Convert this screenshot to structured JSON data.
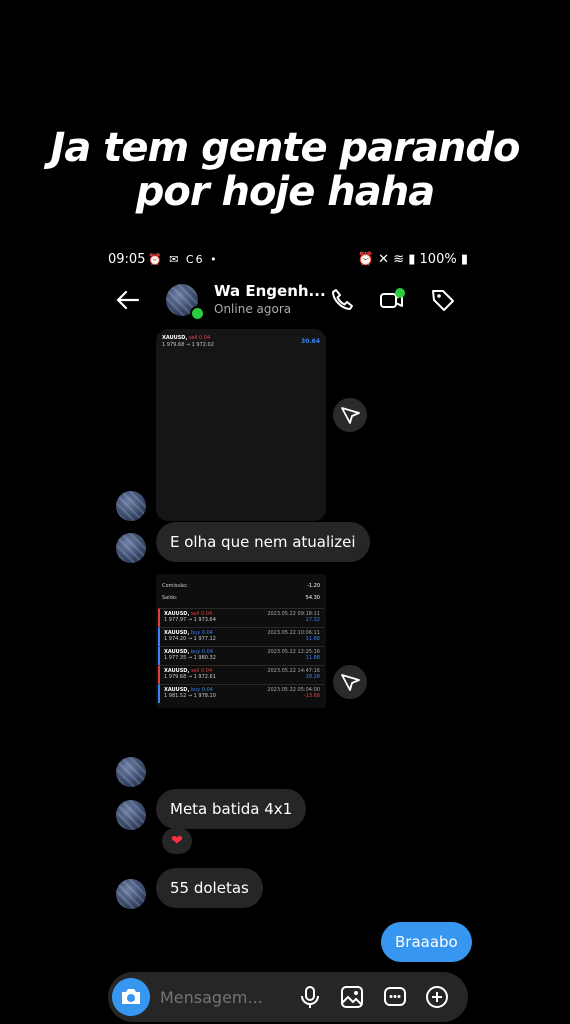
{
  "caption": {
    "line1": "Ja tem gente parando",
    "line2": "por hoje haha"
  },
  "status_bar": {
    "time": "09:05",
    "left_icons": "⏰ ✉ C6 •",
    "battery": "100%"
  },
  "header": {
    "contact_name": "Wa Engenh...",
    "contact_status": "Online agora",
    "icons": [
      "back-arrow-icon",
      "phone-icon",
      "video-call-icon",
      "tag-icon"
    ]
  },
  "messages": {
    "image1": {
      "symbol": "XAUUSD,",
      "side": "sell 0.04",
      "prices": "1 979.68 → 1 972.02",
      "profit": "30.64"
    },
    "text1": "E olha que nem atualizei",
    "image2": {
      "header_rows": [
        {
          "label": "Comissão:",
          "value": "-1.20"
        },
        {
          "label": "Saldo:",
          "value": "54.30"
        }
      ],
      "trades": [
        {
          "symbol": "XAUUSD,",
          "side": "sell 0.04",
          "prices": "1 977.97 → 1 973.64",
          "date": "2023.05.22 09:18:11",
          "profit": "17.32"
        },
        {
          "symbol": "XAUUSD,",
          "side": "buy 0.04",
          "prices": "1 974.20 → 1 977.12",
          "date": "2023.05.22 10:06:11",
          "profit": "11.68"
        },
        {
          "symbol": "XAUUSD,",
          "side": "buy 0.04",
          "prices": "1 977.35 → 1 980.32",
          "date": "2023.05.22 12:25:16",
          "profit": "11.88"
        },
        {
          "symbol": "XAUUSD,",
          "side": "sell 0.04",
          "prices": "1 979.68 → 1 972.61",
          "date": "2023.05.22 14:47:16",
          "profit": "28.28"
        },
        {
          "symbol": "XAUUSD,",
          "side": "buy 0.04",
          "prices": "1 981.52 → 1 978.10",
          "date": "2023.05.22 05:04:00",
          "profit": "-13.68"
        }
      ]
    },
    "text2": "Meta batida 4x1",
    "reaction": "❤",
    "text3": "55 doletas",
    "sent1": "Braaabo"
  },
  "composer": {
    "placeholder": "Mensagem...",
    "icons": [
      "camera-icon",
      "microphone-icon",
      "gallery-icon",
      "sticker-icon",
      "plus-icon"
    ]
  },
  "colors": {
    "background": "#000000",
    "received_bubble": "#262626",
    "sent_bubble": "#3797f0",
    "online": "#2ecc40"
  }
}
